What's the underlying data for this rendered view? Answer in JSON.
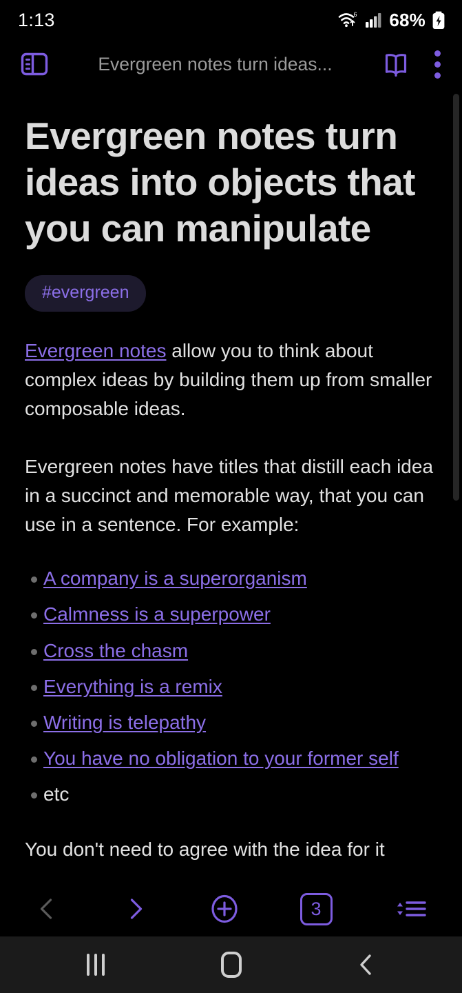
{
  "status_bar": {
    "time": "1:13",
    "wifi_icon": "wifi-6-icon",
    "signal_icon": "cellular-signal-icon",
    "battery_percent": "68%",
    "battery_icon": "battery-charging-icon"
  },
  "app_bar": {
    "sidebar_toggle_icon": "sidebar-panel-icon",
    "document_title": "Evergreen notes turn ideas...",
    "reader_icon": "open-book-icon",
    "overflow_icon": "kebab-menu-icon"
  },
  "note": {
    "title": "Evergreen notes turn ideas into objects that you can manipulate",
    "tags": [
      "#evergreen"
    ],
    "paragraph_1": {
      "link_text": "Evergreen notes",
      "rest": " allow you to think about complex ideas by building them up from smaller composable ideas."
    },
    "paragraph_2": "Evergreen notes have titles that distill each idea in a succinct and memorable way, that you can use in a sentence. For example:",
    "examples": [
      {
        "label": "A company is a superorganism",
        "is_link": true
      },
      {
        "label": "Calmness is a superpower",
        "is_link": true
      },
      {
        "label": "Cross the chasm",
        "is_link": true
      },
      {
        "label": "Everything is a remix",
        "is_link": true
      },
      {
        "label": "Writing is telepathy",
        "is_link": true
      },
      {
        "label": "You have no obligation to your former self",
        "is_link": true
      },
      {
        "label": "etc",
        "is_link": false
      }
    ],
    "paragraph_3_partial": "You don't need to agree with the idea for it"
  },
  "browser_bar": {
    "back_icon": "chevron-left-icon",
    "forward_icon": "chevron-right-icon",
    "new_note_icon": "plus-circle-icon",
    "tab_count": "3",
    "sort_icon": "sort-list-icon"
  },
  "system_nav": {
    "recents_icon": "recents-icon",
    "home_icon": "home-icon",
    "back_icon": "system-back-icon"
  },
  "colors": {
    "background": "#000000",
    "accent_purple": "#7d5ce0",
    "link_purple": "#8c6fe8",
    "tag_background": "#1d1a2d",
    "body_text": "#e2e2e2",
    "title_text": "#dcdcdc",
    "muted_text": "#9b9b9b",
    "disabled_icon": "#5a5a5a",
    "system_nav_background": "#1b1b1b"
  }
}
